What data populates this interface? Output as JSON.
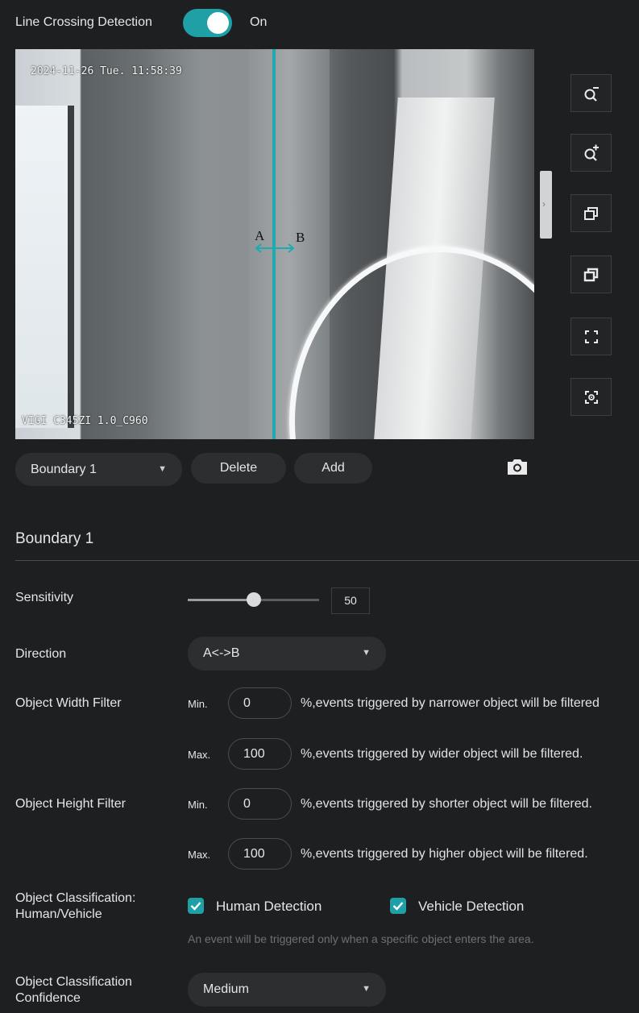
{
  "header": {
    "feature_label": "Line Crossing Detection",
    "toggle_state": "On",
    "toggle_on": true
  },
  "video": {
    "timestamp": "2024-11-26 Tue. 11:58:39",
    "device_label": "VIGI C345ZI 1.0_C960",
    "point_a": "A",
    "point_b": "B",
    "line_color": "#1fa9b0"
  },
  "tools": [
    {
      "icon": "zoom-out-icon"
    },
    {
      "icon": "zoom-in-icon"
    },
    {
      "icon": "restore-window-icon"
    },
    {
      "icon": "window-icon"
    },
    {
      "icon": "fullscreen-icon"
    },
    {
      "icon": "focus-target-icon"
    }
  ],
  "boundary_bar": {
    "selected_boundary": "Boundary 1",
    "delete_label": "Delete",
    "add_label": "Add",
    "snapshot_icon": "camera-icon"
  },
  "section": {
    "title": "Boundary 1"
  },
  "sensitivity": {
    "label": "Sensitivity",
    "value": "50",
    "level_percent": 50
  },
  "direction": {
    "label": "Direction",
    "value": "A<->B"
  },
  "width_filter": {
    "label": "Object Width Filter",
    "min_label": "Min.",
    "min_value": "0",
    "min_hint": "%,events triggered by narrower object will be filtered",
    "max_label": "Max.",
    "max_value": "100",
    "max_hint": "%,events triggered by wider object will be filtered."
  },
  "height_filter": {
    "label": "Object Height Filter",
    "min_label": "Min.",
    "min_value": "0",
    "min_hint": "%,events triggered by shorter object will be filtered.",
    "max_label": "Max.",
    "max_value": "100",
    "max_hint": "%,events triggered by higher object will be filtered."
  },
  "classification": {
    "label_line1": "Object Classification:",
    "label_line2": "Human/Vehicle",
    "human_label": "Human Detection",
    "human_checked": true,
    "vehicle_label": "Vehicle Detection",
    "vehicle_checked": true,
    "note": "An event will be triggered only when a specific object enters the area."
  },
  "confidence": {
    "label_line1": "Object Classification",
    "label_line2": "Confidence",
    "value": "Medium"
  },
  "colors": {
    "accent": "#1fa0a6",
    "background": "#1e1f20"
  }
}
